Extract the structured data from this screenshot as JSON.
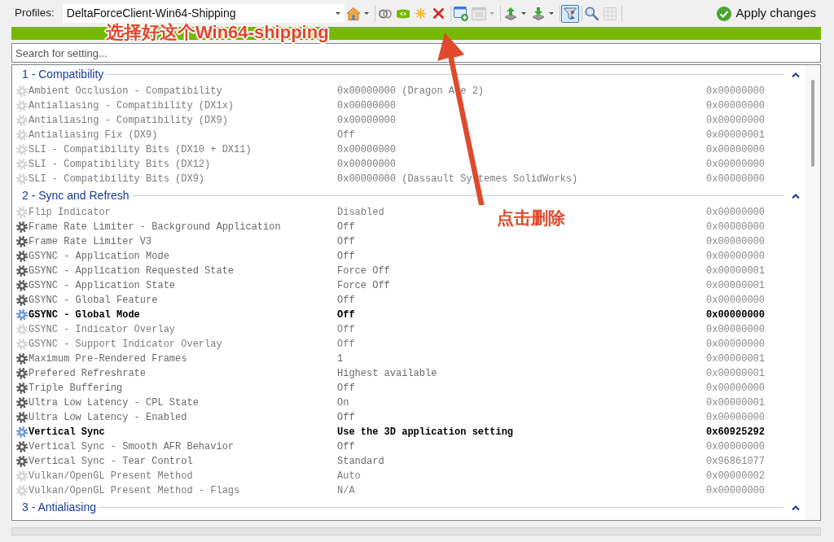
{
  "toolbar": {
    "label": "Profiles:",
    "profile_box": {
      "value": "DeltaForceClient-Win64-Shipping"
    },
    "groups": [
      [
        {
          "kind": "home",
          "menu": true,
          "disabled": false,
          "on": false
        }
      ],
      [
        {
          "kind": "rings",
          "menu": false,
          "disabled": false,
          "on": false
        },
        {
          "kind": "logo",
          "menu": false,
          "disabled": false,
          "on": false
        },
        {
          "kind": "sun",
          "menu": false,
          "disabled": false,
          "on": false
        },
        {
          "kind": "delete",
          "menu": false,
          "disabled": false,
          "on": false
        }
      ],
      [
        {
          "kind": "add_app",
          "menu": false,
          "disabled": false,
          "on": false
        },
        {
          "kind": "app",
          "menu": true,
          "disabled": true,
          "on": false
        }
      ],
      [
        {
          "kind": "import",
          "menu": true,
          "disabled": false,
          "on": false
        },
        {
          "kind": "export",
          "menu": true,
          "disabled": false,
          "on": false
        }
      ],
      [
        {
          "kind": "filter",
          "menu": false,
          "disabled": false,
          "on": true
        }
      ],
      [
        {
          "kind": "search",
          "menu": false,
          "disabled": false,
          "on": false
        },
        {
          "kind": "grid",
          "menu": false,
          "disabled": true,
          "on": false
        }
      ]
    ],
    "apply_button": {
      "label": "Apply changes"
    }
  },
  "search": {
    "placeholder": "Search for setting..."
  },
  "groups": [
    {
      "title": "1 - Compatibility",
      "expanded": true,
      "settings": [
        {
          "name": "Ambient Occlusion - Compatibility",
          "value": "0x00000000 (Dragon A e 2)",
          "hex": "0x00000000",
          "kind": "unset"
        },
        {
          "name": "Antialiasing - Compatibility (DX1x)",
          "value": "0x00000000",
          "hex": "0x00000000",
          "kind": "unset"
        },
        {
          "name": "Antialiasing - Compatibility (DX9)",
          "value": "0x00000000",
          "hex": "0x00000000",
          "kind": "unset"
        },
        {
          "name": "Antialiasing Fix (DX9)",
          "value": "Off",
          "hex": "0x00000001",
          "kind": "unset"
        },
        {
          "name": "SLI - Compatibility Bits (DX10 + DX11)",
          "value": "0x00000000",
          "hex": "0x00000000",
          "kind": "unset"
        },
        {
          "name": "SLI - Compatibility Bits (DX12)",
          "value": "0x00000000",
          "hex": "0x00000000",
          "kind": "unset"
        },
        {
          "name": "SLI - Compatibility Bits (DX9)",
          "value": "0x00000000 (Dassault Sy temes SolidWorks)",
          "hex": "0x00000000",
          "kind": "unset"
        }
      ]
    },
    {
      "title": "2 - Sync and Refresh",
      "expanded": true,
      "settings": [
        {
          "name": "Flip Indicator",
          "value": "Disabled",
          "hex": "0x00000000",
          "kind": "unset"
        },
        {
          "name": "Frame Rate Limiter - Background Application",
          "value": "Off",
          "hex": "0x00000000",
          "kind": "global"
        },
        {
          "name": "Frame Rate Limiter V3",
          "value": "Off",
          "hex": "0x00000000",
          "kind": "global"
        },
        {
          "name": "GSYNC - Application Mode",
          "value": "Off",
          "hex": "0x00000000",
          "kind": "global"
        },
        {
          "name": "GSYNC - Application Requested State",
          "value": "Force Off",
          "hex": "0x00000001",
          "kind": "global"
        },
        {
          "name": "GSYNC - Application State",
          "value": "Force Off",
          "hex": "0x00000001",
          "kind": "global"
        },
        {
          "name": "GSYNC - Global Feature",
          "value": "Off",
          "hex": "0x00000000",
          "kind": "global"
        },
        {
          "name": "GSYNC - Global Mode",
          "value": "Off",
          "hex": "0x00000000",
          "kind": "profile"
        },
        {
          "name": "GSYNC - Indicator Overlay",
          "value": "Off",
          "hex": "0x00000000",
          "kind": "unset"
        },
        {
          "name": "GSYNC - Support Indicator Overlay",
          "value": "Off",
          "hex": "0x00000000",
          "kind": "unset"
        },
        {
          "name": "Maximum Pre-Rendered Frames",
          "value": "1",
          "hex": "0x00000001",
          "kind": "global"
        },
        {
          "name": "Prefered Refreshrate",
          "value": "Highest available",
          "hex": "0x00000001",
          "kind": "global"
        },
        {
          "name": "Triple Buffering",
          "value": "Off",
          "hex": "0x00000000",
          "kind": "global"
        },
        {
          "name": "Ultra Low Latency - CPL State",
          "value": "On",
          "hex": "0x00000001",
          "kind": "global"
        },
        {
          "name": "Ultra Low Latency - Enabled",
          "value": "Off",
          "hex": "0x00000000",
          "kind": "global"
        },
        {
          "name": "Vertical Sync",
          "value": "Use the 3D application setting",
          "hex": "0x60925292",
          "kind": "profile"
        },
        {
          "name": "Vertical Sync - Smooth AFR Behavior",
          "value": "Off",
          "hex": "0x00000000",
          "kind": "global"
        },
        {
          "name": "Vertical Sync - Tear Control",
          "value": "Standard",
          "hex": "0x96861077",
          "kind": "global"
        },
        {
          "name": "Vulkan/OpenGL Present Method",
          "value": "Auto",
          "hex": "0x00000002",
          "kind": "unset"
        },
        {
          "name": "Vulkan/OpenGL Present Method - Flags",
          "value": "N/A",
          "hex": "0x00000000",
          "kind": "unset"
        }
      ]
    },
    {
      "title": "3 - Antialiasing",
      "expanded": true
    }
  ],
  "annotations": {
    "profile_note": "选择好这个Win64-shipping",
    "delete_note": "点击删除"
  }
}
